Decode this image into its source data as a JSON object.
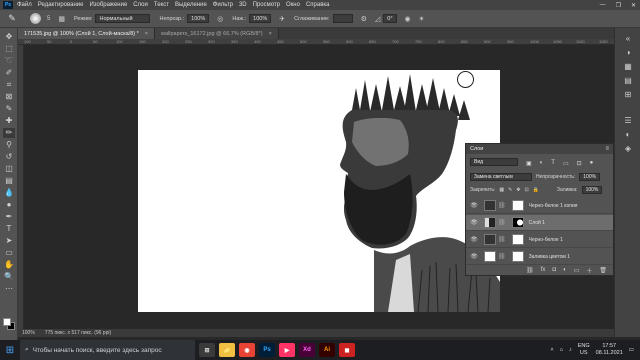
{
  "menu": {
    "app_badge": "Ps",
    "items": [
      "Файл",
      "Редактирование",
      "Изображение",
      "Слои",
      "Текст",
      "Выделение",
      "Фильтр",
      "3D",
      "Просмотр",
      "Окно",
      "Справка"
    ],
    "minimize": "—",
    "maximize": "❐",
    "close": "✕"
  },
  "options": {
    "brush_size": "5",
    "mode_label": "Режим:",
    "mode_value": "Нормальный",
    "opacity_label": "Непрозр.:",
    "opacity_value": "100%",
    "pressure_label": "Наж.:",
    "pressure_value": "100%",
    "smoothing_label": "Сглаживание:",
    "angle_value": "0°"
  },
  "tabs": [
    {
      "label": "171535.jpg @ 100% (Слой 1, Слой-маска/8) *",
      "close": "×"
    },
    {
      "label": "wallpapers_16172.jpg @ 66,7% (RGB/8*)",
      "close": "×"
    }
  ],
  "ruler": [
    "100",
    "50",
    "0",
    "50",
    "100",
    "150",
    "200",
    "250",
    "300",
    "350",
    "400",
    "450",
    "500",
    "550",
    "600",
    "650",
    "700",
    "750",
    "800",
    "850",
    "900",
    "950",
    "1000",
    "1050",
    "1100",
    "1150"
  ],
  "status": {
    "zoom": "100%",
    "doc_info": "775 пикс. x 517 пикс. (96 ppi)"
  },
  "layers_panel": {
    "title": "Слои",
    "filter_value": "Вид",
    "blend_mode": "Замена светлым",
    "opacity_label": "Непрозрачность:",
    "opacity_value": "100%",
    "lock_label": "Закрепить:",
    "fill_label": "Заливка:",
    "fill_value": "100%",
    "layers": [
      {
        "name": "Черно-белое 1 копия"
      },
      {
        "name": "Слой 1"
      },
      {
        "name": "Черно-белое 1"
      },
      {
        "name": "Заливка цветом 1"
      }
    ],
    "footer_icons": [
      "⛓",
      "fx",
      "◘",
      "◐",
      "▭",
      "＋",
      "🗑"
    ]
  },
  "taskbar": {
    "search_placeholder": "Чтобы начать поиск, введите здесь запрос",
    "apps": [
      {
        "label": "⊞",
        "color": "#3a3a3a",
        "text": "#dddddd"
      },
      {
        "label": "📁",
        "color": "#f0c040",
        "text": "#333333"
      },
      {
        "label": "◉",
        "color": "#e94335",
        "text": "#ffffff"
      },
      {
        "label": "Ps",
        "color": "#001e36",
        "text": "#31a8ff"
      },
      {
        "label": "▶",
        "color": "#ff3366",
        "text": "#ffffff"
      },
      {
        "label": "Xd",
        "color": "#470137",
        "text": "#ff61f6"
      },
      {
        "label": "Ai",
        "color": "#330000",
        "text": "#ff9a00"
      },
      {
        "label": "◼",
        "color": "#cc2222",
        "text": "#ffffff"
      }
    ],
    "lang": "ENG",
    "region": "US",
    "time": "17:57",
    "date": "08.11.2021"
  }
}
